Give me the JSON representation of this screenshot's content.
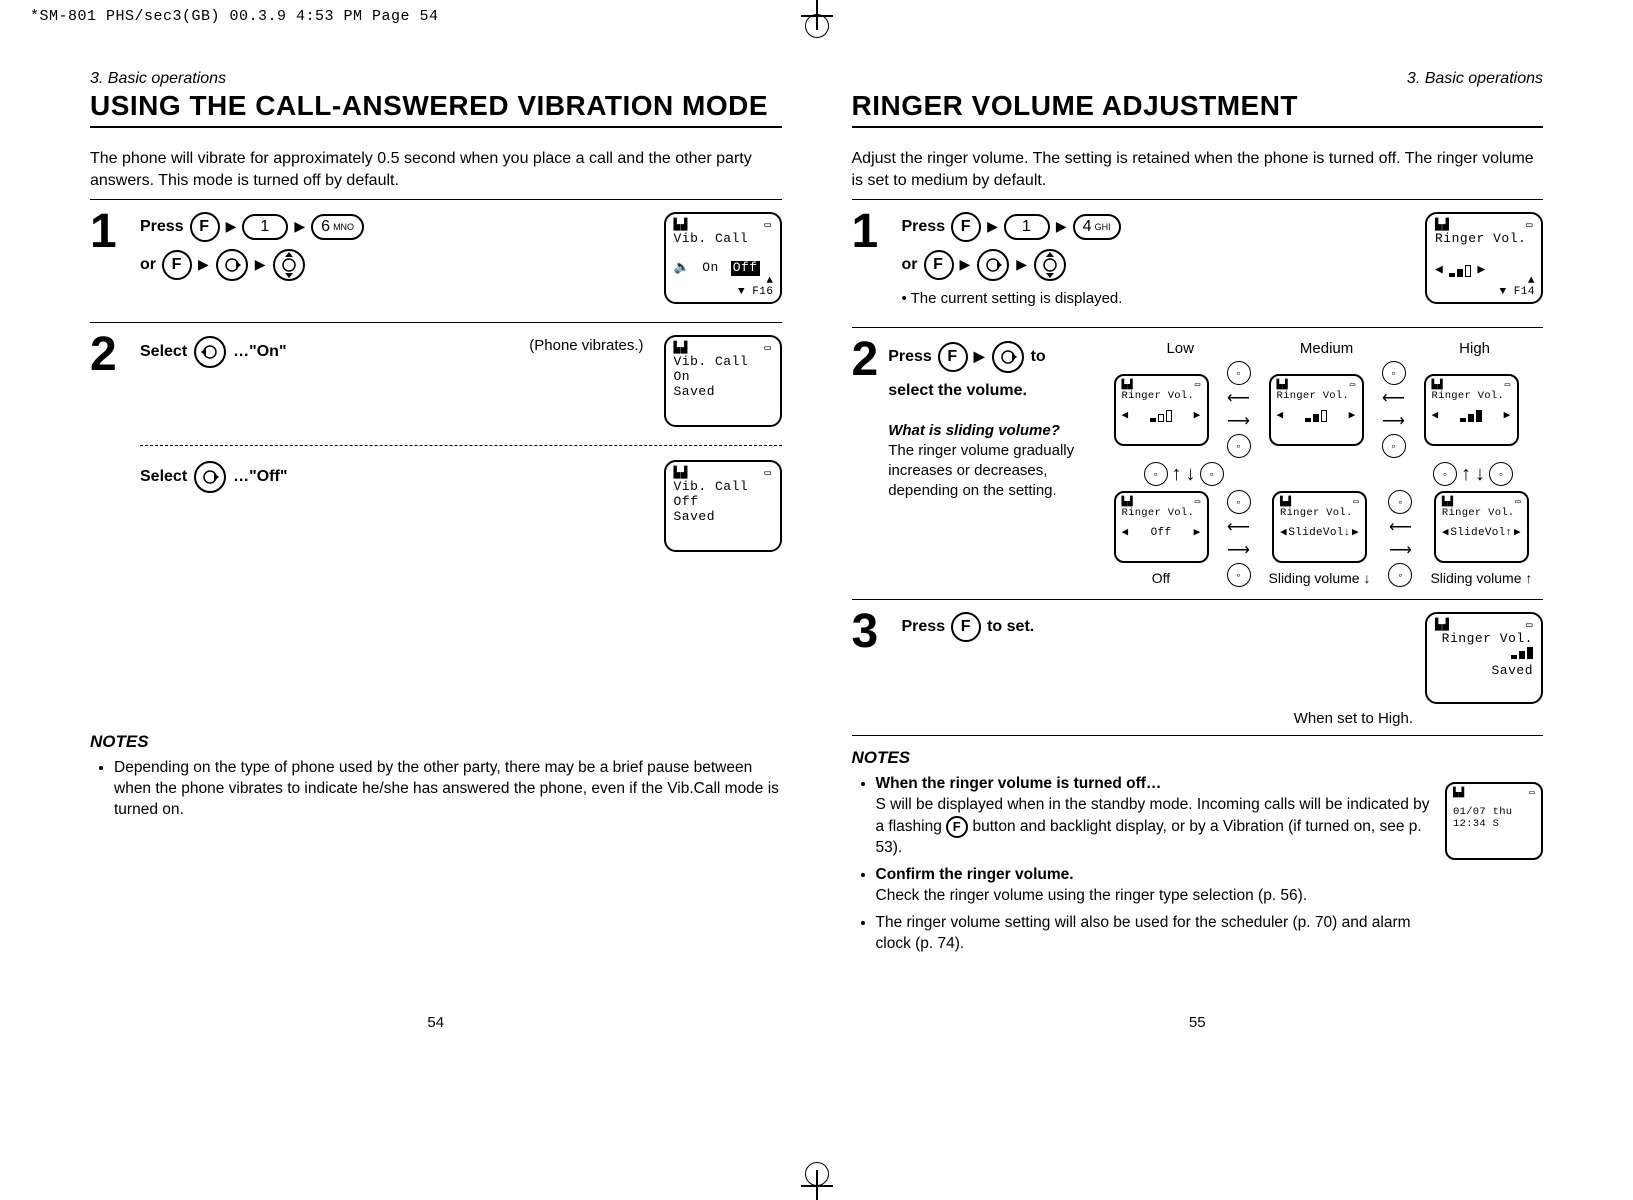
{
  "print_header": "*SM-801 PHS/sec3(GB)  00.3.9 4:53 PM  Page 54",
  "left": {
    "section": "3. Basic operations",
    "title": "USING THE CALL-ANSWERED VIBRATION MODE",
    "lead": "The phone will vibrate for approximately 0.5 second when you place a call and the other party answers. This mode is turned off by default.",
    "step1_press": "Press",
    "step1_or": "or",
    "key_F": "F",
    "key_1": "1",
    "key_6": "6",
    "key_6_sub": "MNO",
    "screen1_l1": "Vib. Call",
    "screen1_on": "On",
    "screen1_off": "Off",
    "screen1_fn": "F16",
    "step2_select": "Select",
    "step2_on": "…\"On\"",
    "step2_phone_vibrates": "(Phone vibrates.)",
    "screen2_l1": "Vib. Call",
    "screen2_l2": "On",
    "screen2_l3": "Saved",
    "step2b_select": "Select",
    "step2b_off": "…\"Off\"",
    "screen3_l1": "Vib. Call",
    "screen3_l2": "Off",
    "screen3_l3": "Saved",
    "notes_title": "NOTES",
    "note1": "Depending on the type of phone used by the other party, there may be a brief pause between when the phone vibrates to indicate he/she has answered the phone, even if the Vib.Call mode is turned on.",
    "page_no": "54"
  },
  "right": {
    "section": "3. Basic operations",
    "title": "RINGER VOLUME ADJUSTMENT",
    "lead": "Adjust the ringer volume. The setting is retained when the phone is turned off. The ringer volume is set to medium by default.",
    "step1_press": "Press",
    "step1_or": "or",
    "key_4": "4",
    "key_4_sub": "GHI",
    "step1_note": "• The current setting is displayed.",
    "screen1_l1": "Ringer Vol.",
    "screen1_fn": "F14",
    "step2_press": "Press",
    "step2_to": "to",
    "step2_text": "select the volume.",
    "vol_low": "Low",
    "vol_med": "Medium",
    "vol_high": "High",
    "vol_label": "Ringer Vol.",
    "vol_off": "Off",
    "vol_slide_down": "SlideVol↓",
    "vol_slide_up": "SlideVol↑",
    "caption_off": "Off",
    "caption_sd": "Sliding volume ↓",
    "caption_su": "Sliding volume ↑",
    "sliding_q": "What is sliding volume?",
    "sliding_a": "The ringer volume gradually increases or decreases, depending on the setting.",
    "step3_press": "Press",
    "step3_text": " to set.",
    "step3_caption": "When set to High.",
    "screen3_l1": "Ringer Vol.",
    "screen3_l2_saved": "Saved",
    "notes_title": "NOTES",
    "note1_h": "When the ringer volume is turned off…",
    "note1_b1": "S will be displayed when in the standby mode. Incoming calls will be indicated by a flashing ",
    "note1_b2": " button and backlight display, or by a Vibration (if turned on, see p. 53).",
    "note2_h": "Confirm the ringer volume.",
    "note2_b": "Check the ringer volume using the ringer type selection (p. 56).",
    "note3": "The ringer volume setting will also be used for the scheduler (p. 70) and alarm clock (p. 74).",
    "standby_l1": "01/07 thu",
    "standby_l2": " 12:34 S",
    "page_no": "55"
  }
}
